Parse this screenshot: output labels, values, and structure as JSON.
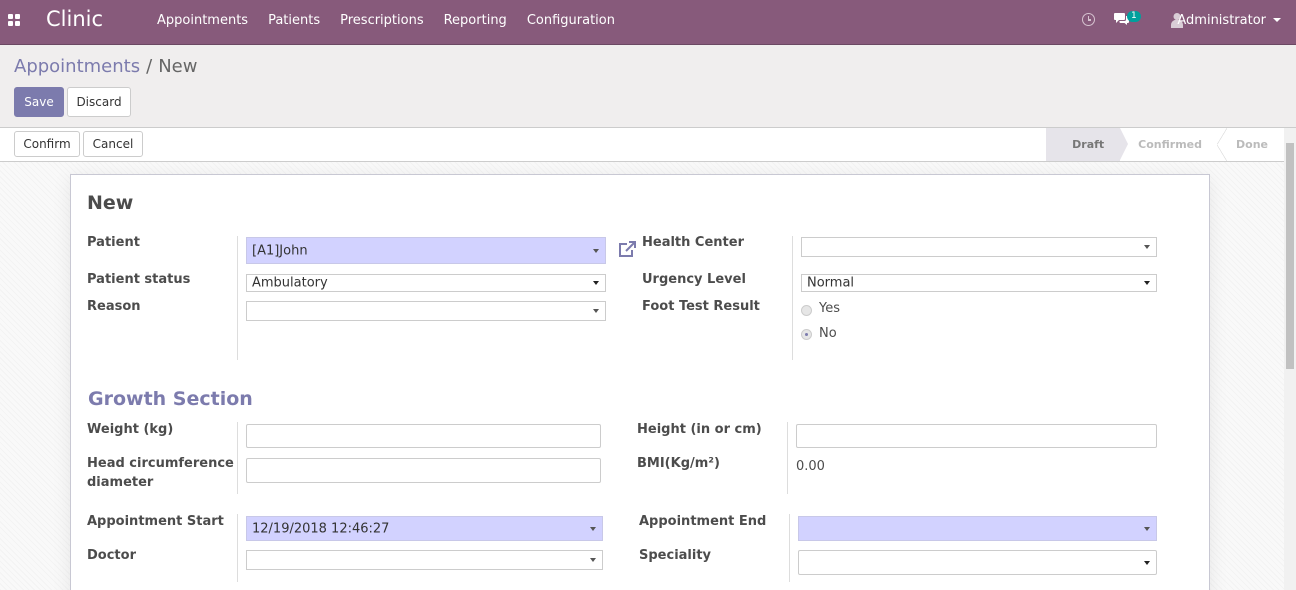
{
  "nav": {
    "brand": "Clinic",
    "menu": [
      "Appointments",
      "Patients",
      "Prescriptions",
      "Reporting",
      "Configuration"
    ],
    "chat_count": "1",
    "user": "Administrator"
  },
  "control": {
    "breadcrumb_parent": "Appointments",
    "breadcrumb_separator": "/",
    "breadcrumb_current": "New",
    "save_label": "Save",
    "discard_label": "Discard"
  },
  "statusbar": {
    "confirm_label": "Confirm",
    "cancel_label": "Cancel",
    "stages": [
      "Draft",
      "Confirmed",
      "Done"
    ],
    "active_stage": "Draft"
  },
  "form": {
    "title": "New",
    "patient": {
      "label": "Patient",
      "value": "[A1]John"
    },
    "patient_status": {
      "label": "Patient status",
      "value": "Ambulatory"
    },
    "reason": {
      "label": "Reason",
      "value": ""
    },
    "health_center": {
      "label": "Health Center",
      "value": ""
    },
    "urgency_level": {
      "label": "Urgency Level",
      "value": "Normal"
    },
    "foot_test_result": {
      "label": "Foot Test Result",
      "options": [
        "Yes",
        "No"
      ],
      "selected": "No"
    },
    "growth_section_title": "Growth Section",
    "weight": {
      "label": "Weight (kg)",
      "value": ""
    },
    "head_circumference": {
      "label_line1": "Head circumference",
      "label_line2": "diameter",
      "value": ""
    },
    "height": {
      "label": "Height (in or cm)",
      "value": ""
    },
    "bmi": {
      "label": "BMI(Kg/m²)",
      "value": "0.00"
    },
    "appointment_start": {
      "label": "Appointment Start",
      "value": "12/19/2018 12:46:27"
    },
    "appointment_end": {
      "label": "Appointment End",
      "value": ""
    },
    "doctor": {
      "label": "Doctor",
      "value": ""
    },
    "speciality": {
      "label": "Speciality",
      "value": ""
    }
  },
  "colors": {
    "navbar": "#875a7b",
    "accent": "#7c7bad",
    "required_field": "#d2d2ff",
    "badge": "#00a09d"
  }
}
